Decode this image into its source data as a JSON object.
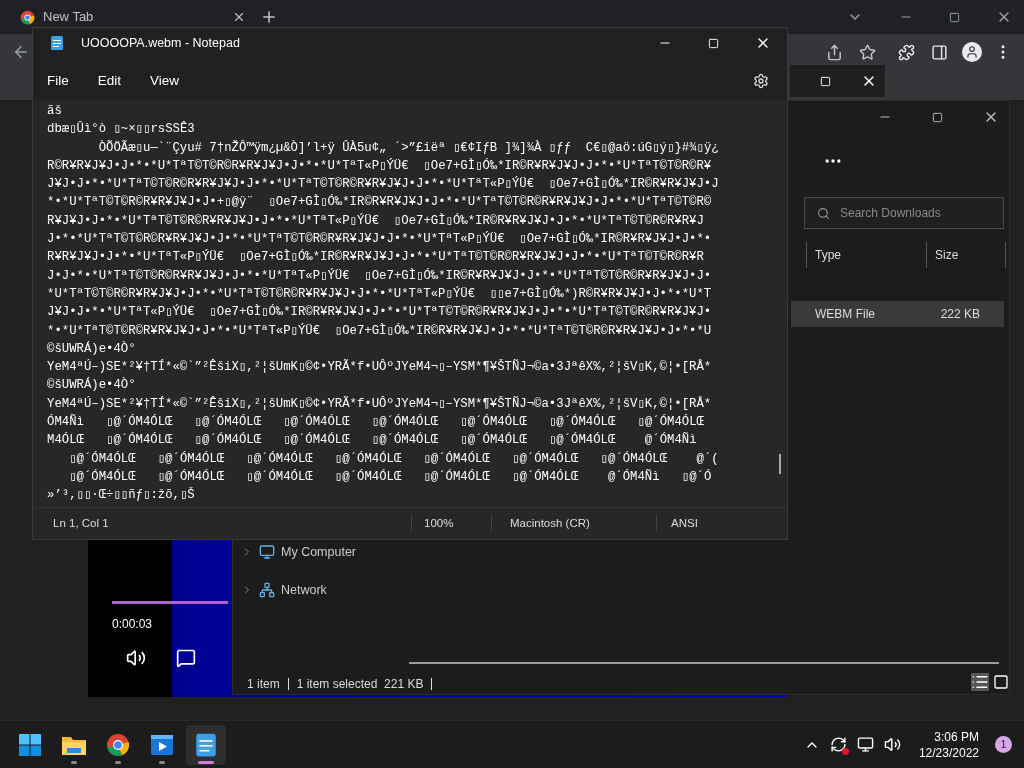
{
  "browser": {
    "tab": {
      "title": "New Tab"
    }
  },
  "media_player": {
    "time": "0:00:03"
  },
  "explorer": {
    "search": {
      "placeholder": "Search Downloads"
    },
    "columns": [
      "Type",
      "Size"
    ],
    "rows": [
      {
        "type": "WEBM File",
        "size": "222 KB",
        "selected": true
      }
    ],
    "nav": [
      {
        "label": "My Computer",
        "kind": "computer"
      },
      {
        "label": "Network",
        "kind": "network"
      }
    ],
    "status": [
      "1 item",
      "1 item selected  221 KB"
    ]
  },
  "notepad": {
    "title": "UOOOOPA.webm - Notepad",
    "menus": [
      "File",
      "Edit",
      "View"
    ],
    "lines": [
      "ãš",
      "dbæ▯Ûì°ò ▯~×▯▯rsSSÊ3",
      "       ÒÕÖÃæ▯u—`¨Çyu# 7†nŽÔ™ÿm¿µ&Ò]’l+ÿ ÛÀ5u¢„ ´>”£iëª ▯€¢IƒB ]¾]¾À ▯ƒƒ  C€▯@aö:úG▯ý▯}#¾▯ÿ¿",
      "R©R¥R¥J¥J•J•*•*U*TªT©T©R©R¥R¥J¥J•J•*•*U*TªT«P▯ÝÜ€  ▯Oe7+GÌ▯Ó‰*IR©R¥R¥J¥J•J•*•*U*TªT©T©R©R¥",
      "J¥J•J•*•*U*TªT©T©R©R¥R¥J¥J•J•*•*U*TªT©T©R©R¥R¥J¥J•J•*•*U*TªT«P▯ÝÜ€  ▯Oe7+GÌ▯Ó‰*IR©R¥R¥J¥J•J",
      "*•*U*TªT©T©R©R¥R¥J¥J•J•+▯@ÿ¨  ▯Oe7+GÌ▯Ó‰*IR©R¥R¥J¥J•J•*•*U*TªT©T©R©R¥R¥J¥J•J•*•*U*TªT©T©R©",
      "R¥J¥J•J•*•*U*TªT©T©R©R¥R¥J¥J•J•*•*U*TªT«P▯ÝÜ€  ▯Oe7+GÌ▯Ó‰*IR©R¥R¥J¥J•J•*•*U*TªT©T©R©R¥R¥J",
      "J•*•*U*TªT©T©R©R¥R¥J¥J•J•*•*U*TªT©T©R©R¥R¥J¥J•J•*•*U*TªT«P▯ÝÜ€  ▯Oe7+GÌ▯Ó‰*IR©R¥R¥J¥J•J•*•",
      "R¥R¥J¥J•J•*•*U*TªT«P▯ÝÜ€  ▯Oe7+GÌ▯Ó‰*IR©R¥R¥J¥J•J•*•*U*TªT©T©R©R¥R¥J¥J•J•*•*U*TªT©T©R©R¥R",
      "J•J•*•*U*TªT©T©R©R¥R¥J¥J•J•*•*U*TªT«P▯ÝÜ€  ▯Oe7+GÌ▯Ó‰*IR©R¥R¥J¥J•J•*•*U*TªT©T©R©R¥R¥J¥J•J•",
      "*U*TªT©T©R©R¥R¥J¥J•J•*•*U*TªT©T©R©R¥R¥J¥J•J•*•*U*TªT«P▯ÝÜ€  ▯▯e7+GÌ▯Ó‰*)R©R¥R¥J¥J•J•*•*U*T",
      "J¥J•J•*•*U*TªT«P▯ÝÜ€  ▯Oe7+GÌ▯Ó‰*IR©R¥R¥J¥J•J•*•*U*TªT©T©R©R¥R¥J¥J•J•*•*U*TªT©T©R©R¥R¥J¥J•",
      "*•*U*TªT©T©R©R¥R¥J¥J•J•*•*U*TªT«P▯ÝÜ€  ▯Oe7+GÌ▯Ó‰*IR©R¥R¥J¥J•J•*•*U*TªT©T©R©R¥R¥J¥J•J•*•*U",
      "©šUWRÁ)e•4Ò°",
      "YeM4ªÚ–)SE*²¥†TÍ*«©`”²ÊšiX▯,²¦šUmK▯©¢•YRÃ*f•UÔºJYeM4¬▯–YSM*¶¥ŠTÑJ¬©a•3JªêX%,²¦šV▯K,©¦•[RÅ*",
      "©šUWRÁ)e•4Ò°",
      "YeM4ªÚ–)SE*²¥†TÍ*«©`”²ÊšiX▯,²¦šUmK▯©¢•YRÃ*f•UÔºJYeM4¬▯–YSM*¶¥ŠTÑJ¬©a•3JªêX%,²¦šV▯K,©¦•[RÅ*",
      "ÓM4Ñì   ▯@´ÓM4ÓLŒ   ▯@´ÓM4ÓLŒ   ▯@´ÓM4ÓLŒ   ▯@´ÓM4ÓLŒ   ▯@´ÓM4ÓLŒ   ▯@´ÓM4ÓLŒ   ▯@´ÓM4ÓLŒ",
      "M4ÓLŒ   ▯@´ÓM4ÓLŒ   ▯@´ÓM4ÓLŒ   ▯@´ÓM4ÓLŒ   ▯@´ÓM4ÓLŒ   ▯@´ÓM4ÓLŒ   ▯@´ÓM4ÓLŒ    @´ÓM4Ñì",
      "   ▯@´ÓM4ÓLŒ   ▯@´ÓM4ÓLŒ   ▯@´ÓM4ÓLŒ   ▯@´ÓM4ÓLŒ   ▯@´ÓM4ÓLŒ   ▯@´ÓM4ÓLŒ   ▯@´ÓM4ÓLŒ    @´(",
      "   ▯@´ÓM4ÓLŒ   ▯@´ÓM4ÓLŒ   ▯@´ÓM4ÓLŒ   ▯@´ÓM4ÓLŒ   ▯@´ÓM4ÓLŒ   ▯@´ÓM4ÓLŒ    @´ÓM4Ñì   ▯@´Ó",
      "»’³,▯▯·Œ÷▯▯ñƒ▯:žõ,▯Š"
    ],
    "status": {
      "position": "Ln 1, Col 1",
      "zoom": "100%",
      "line_ending": "Macintosh (CR)",
      "encoding": "ANSI"
    }
  },
  "taskbar": {
    "apps": [
      {
        "kind": "start",
        "selected": false
      },
      {
        "kind": "explorer",
        "selected": false
      },
      {
        "kind": "chrome",
        "selected": false
      },
      {
        "kind": "media",
        "selected": false
      },
      {
        "kind": "notepad",
        "selected": true
      }
    ],
    "time": "3:06 PM",
    "date": "12/23/2022",
    "notifications": "1"
  }
}
